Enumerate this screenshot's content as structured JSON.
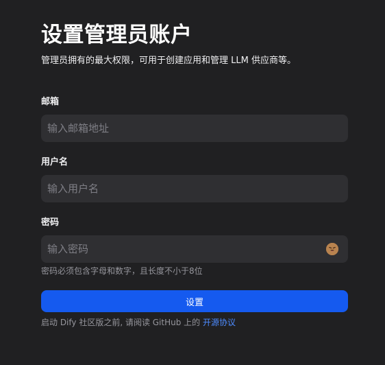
{
  "header": {
    "title": "设置管理员账户",
    "subtitle": "管理员拥有的最大权限，可用于创建应用和管理 LLM 供应商等。"
  },
  "form": {
    "email": {
      "label": "邮箱",
      "placeholder": "输入邮箱地址",
      "value": ""
    },
    "username": {
      "label": "用户名",
      "placeholder": "输入用户名",
      "value": ""
    },
    "password": {
      "label": "密码",
      "placeholder": "输入密码",
      "value": "",
      "toggle_icon": "eye-toggle-icon",
      "hint": "密码必须包含字母和数字，且长度不小于8位"
    },
    "submit_label": "设置"
  },
  "footer": {
    "text": "启动 Dify 社区版之前, 请阅读 GitHub 上的 ",
    "link_label": "开源协议"
  },
  "colors": {
    "background": "#202022",
    "input_background": "#2f2f32",
    "primary": "#155aef",
    "link": "#4d8bff",
    "muted_text": "#96969d"
  }
}
